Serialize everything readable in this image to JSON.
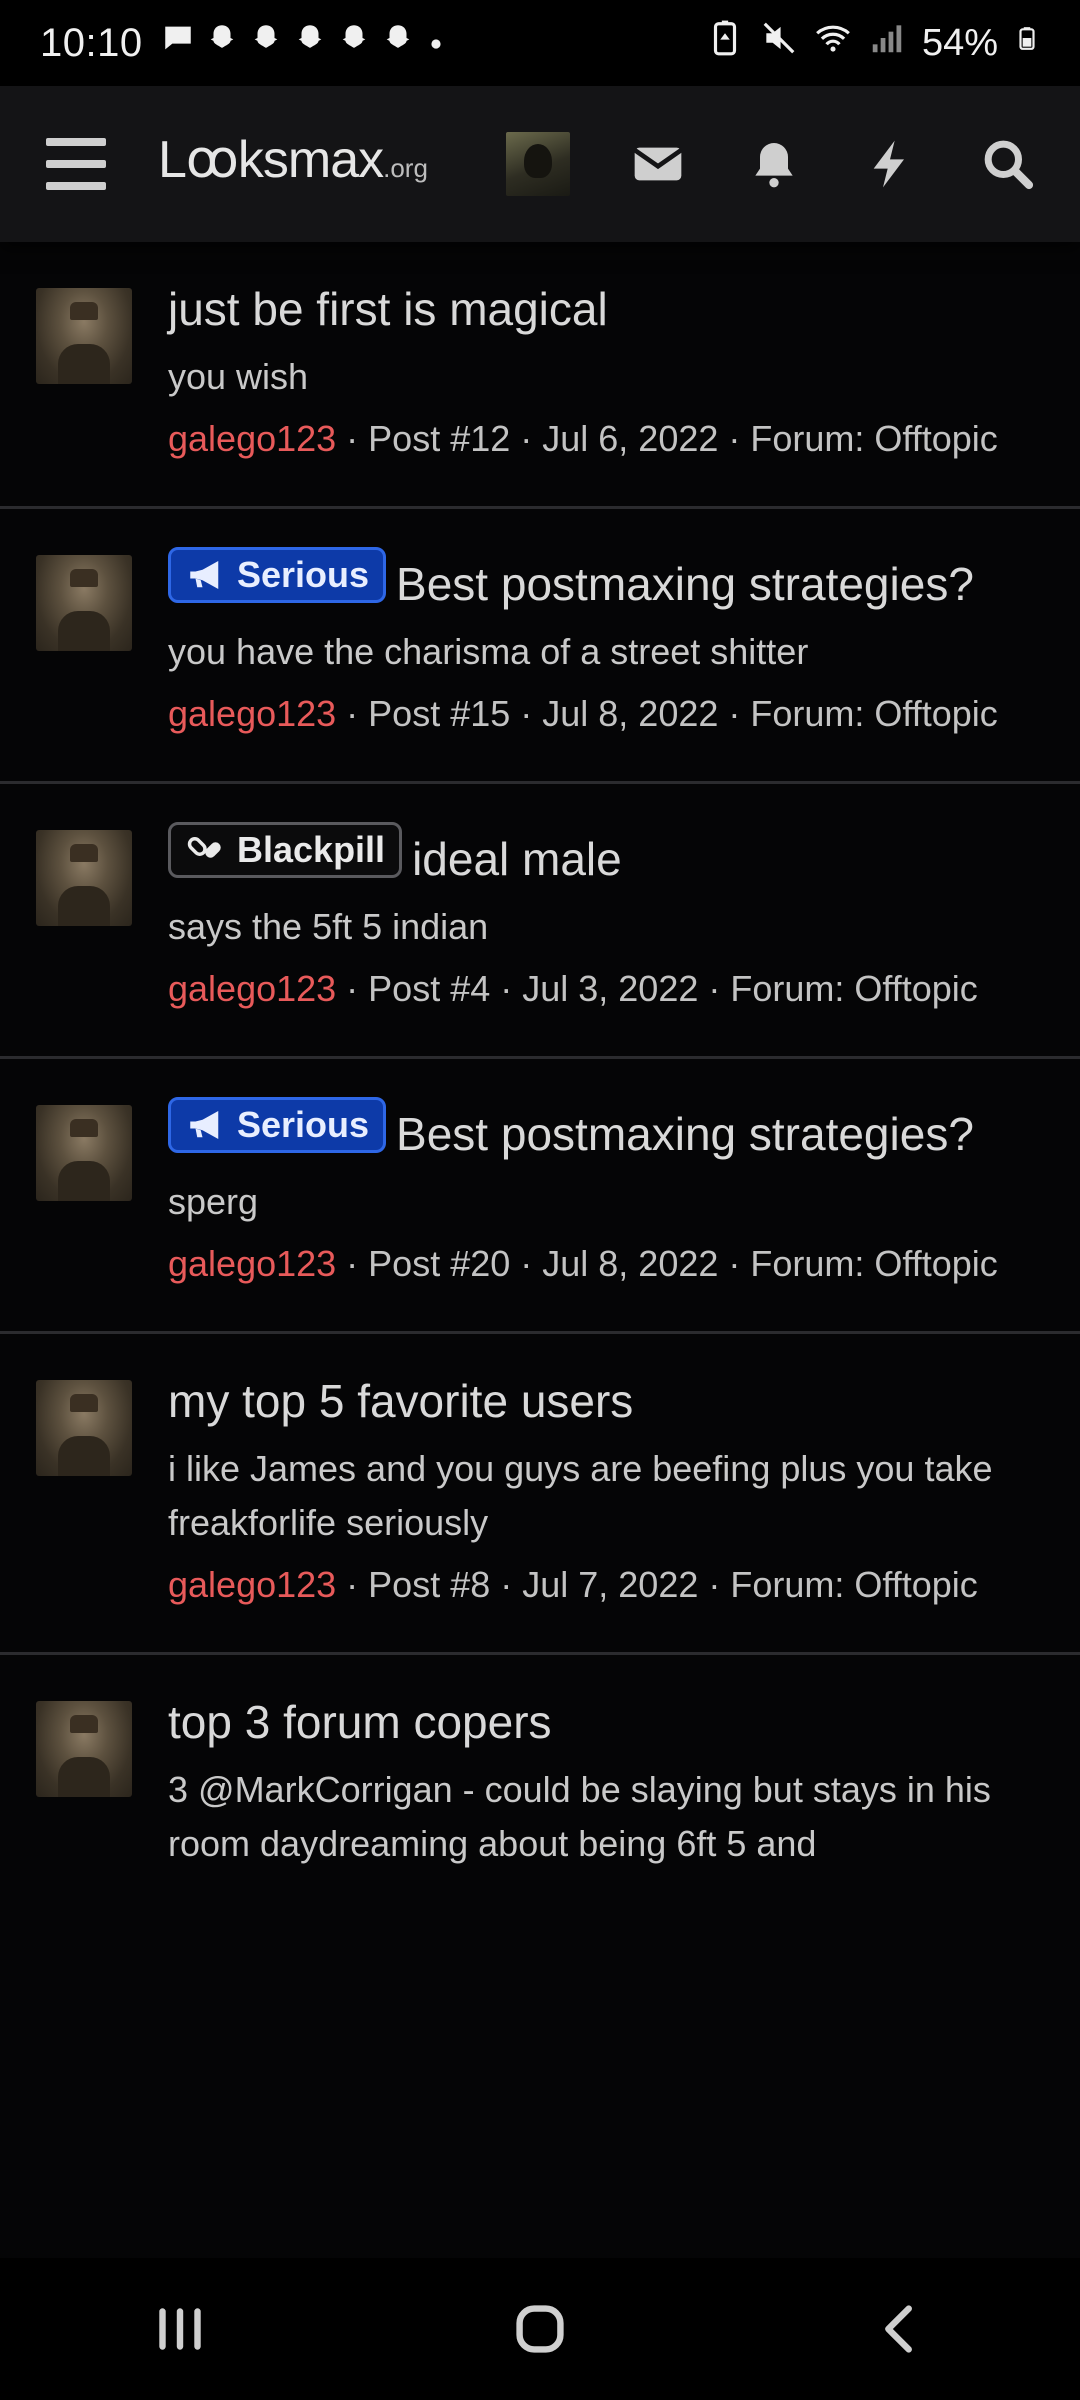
{
  "status_bar": {
    "time": "10:10",
    "notification_icons": [
      "chat-icon",
      "snapchat-icon",
      "snapchat-icon",
      "snapchat-icon",
      "snapchat-icon",
      "snapchat-icon",
      "dot-icon"
    ],
    "battery_percent": "54%"
  },
  "header": {
    "logo_main": "Lꝏksmax",
    "logo_tld": ".org",
    "icons": [
      "menu-icon",
      "avatar",
      "mail-icon",
      "bell-icon",
      "bolt-icon",
      "search-icon"
    ]
  },
  "results": [
    {
      "badge": null,
      "title": "just be first is magical",
      "snippet": "you wish",
      "author": "galego123",
      "meta": " · Post #12 · Jul 6, 2022 · Forum: Offtopic"
    },
    {
      "badge": "Serious",
      "title": "Best postmaxing strategies?",
      "snippet": "you have the charisma of a street shitter",
      "author": "galego123",
      "meta": " · Post #15 · Jul 8, 2022 · Forum: Offtopic"
    },
    {
      "badge": "Blackpill",
      "title": "ideal male",
      "snippet": "says the 5ft 5 indian",
      "author": "galego123",
      "meta": " · Post #4 · Jul 3, 2022 · Forum: Offtopic"
    },
    {
      "badge": "Serious",
      "title": "Best postmaxing strategies?",
      "snippet": "sperg",
      "author": "galego123",
      "meta": " · Post #20 · Jul 8, 2022 · Forum: Offtopic"
    },
    {
      "badge": null,
      "title": "my top 5 favorite users",
      "snippet": "i like James and you guys are beefing plus you take freakforlife seriously",
      "author": "galego123",
      "meta": " · Post #8 · Jul 7, 2022 · Forum: Offtopic"
    },
    {
      "badge": null,
      "title": "top 3 forum copers",
      "snippet": "3 @MarkCorrigan - could be slaying but stays in his room daydreaming about being 6ft 5 and",
      "author": "",
      "meta": ""
    }
  ],
  "colors": {
    "author": "#e85a5a",
    "serious_badge": "#0d3aa8",
    "background": "#050506"
  },
  "nav_bar": [
    "recents-icon",
    "home-icon",
    "back-icon"
  ]
}
